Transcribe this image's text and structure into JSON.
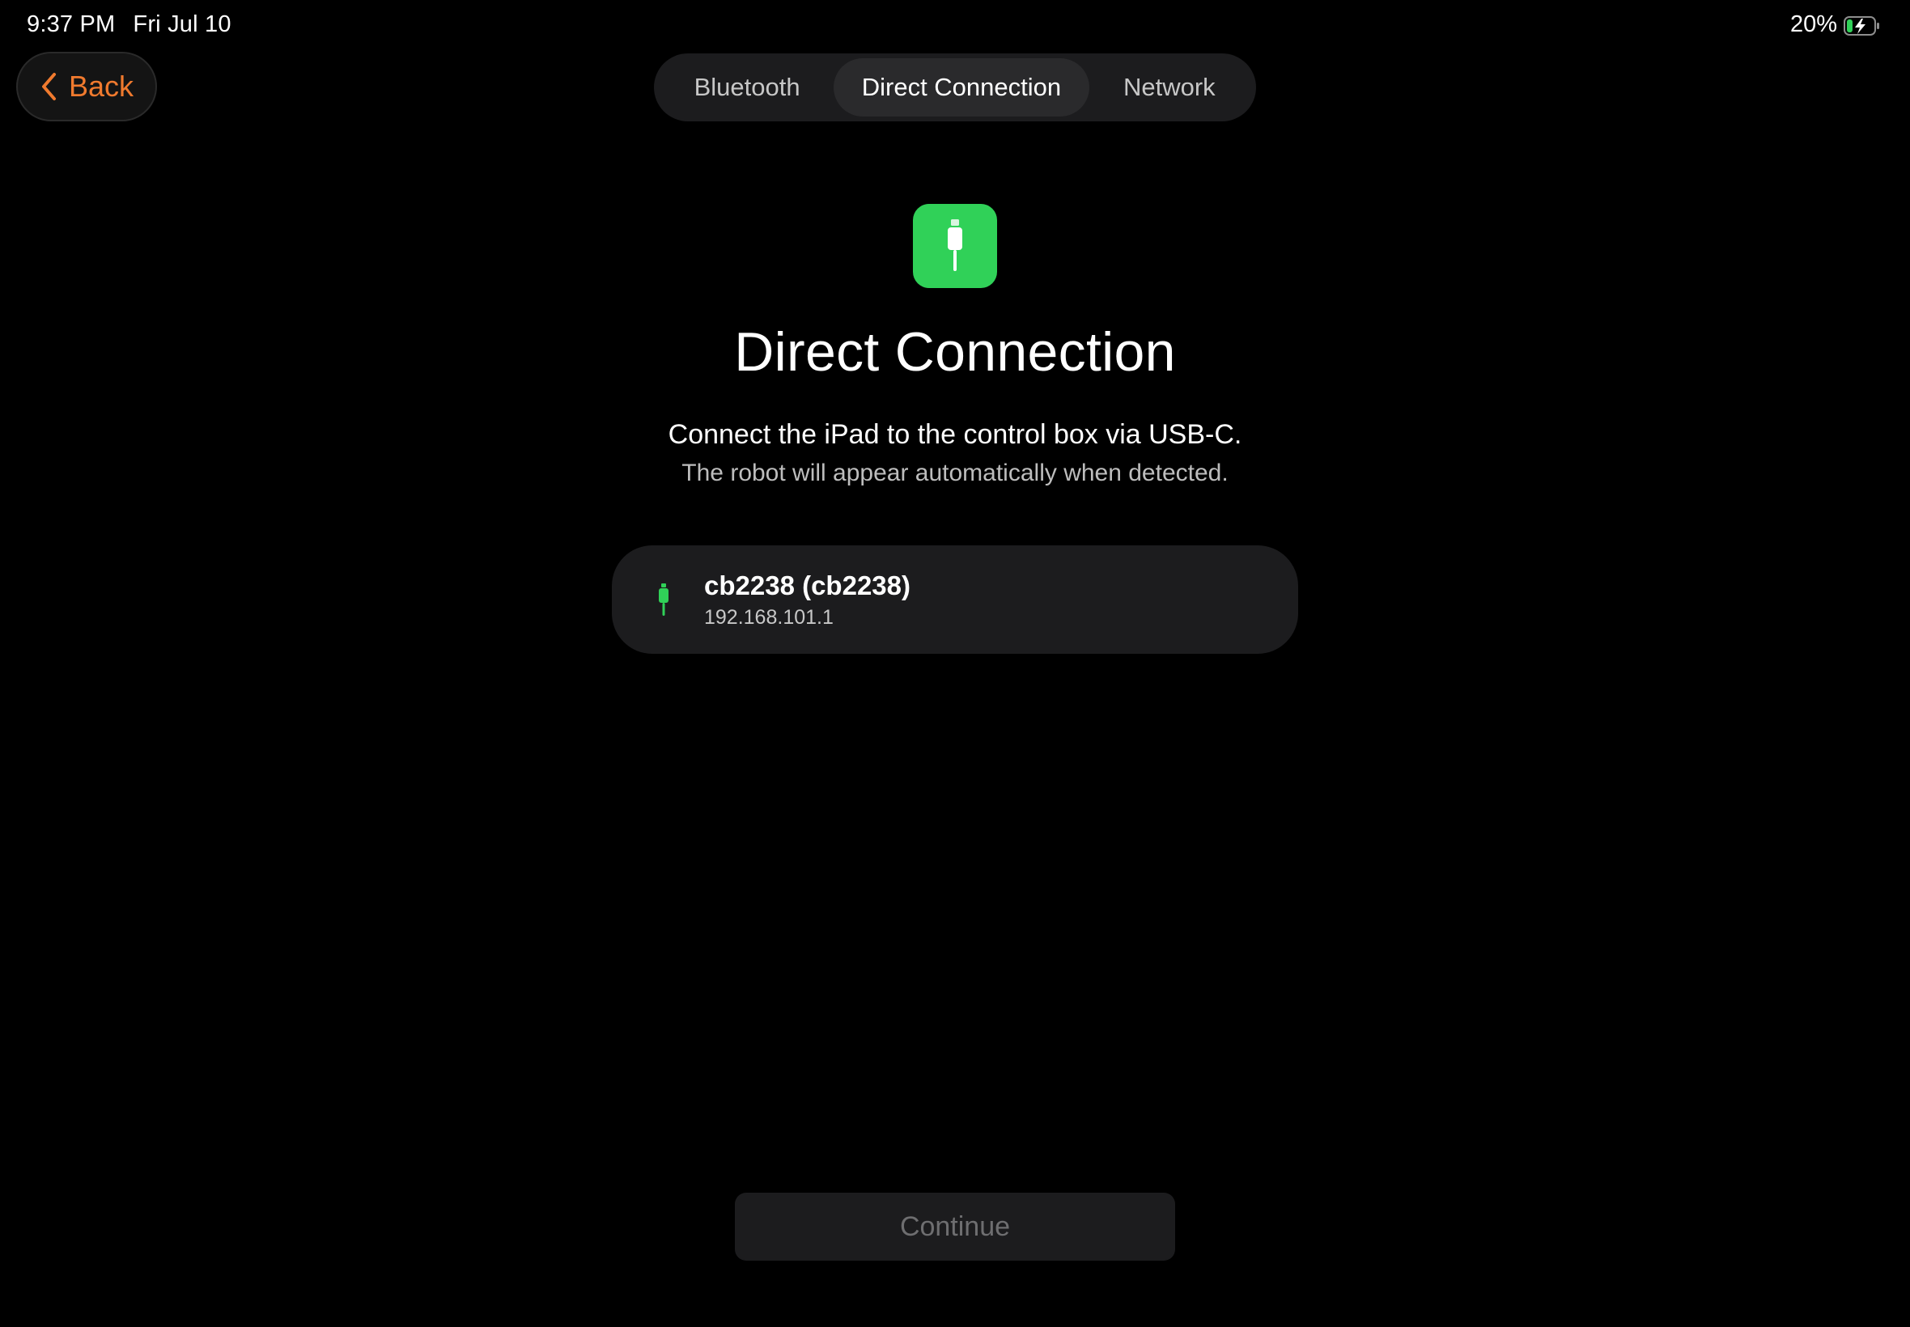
{
  "status_bar": {
    "time": "9:37 PM",
    "date": "Fri Jul 10",
    "battery_percent": "20%",
    "battery_level": 0.2,
    "battery_icon": "battery-charging-icon"
  },
  "nav": {
    "back_label": "Back",
    "back_icon": "chevron-left-icon",
    "accent_color": "#f07a2e"
  },
  "tabs": [
    {
      "label": "Bluetooth",
      "selected": false
    },
    {
      "label": "Direct Connection",
      "selected": true
    },
    {
      "label": "Network",
      "selected": false
    }
  ],
  "main": {
    "icon": "usb-cable-icon",
    "icon_color": "#30d158",
    "title": "Direct Connection",
    "subtitle": "Connect the iPad to the control box via USB-C.",
    "description": "The robot will appear automatically when detected."
  },
  "devices": [
    {
      "name": "cb2238 (cb2238)",
      "address": "192.168.101.1",
      "icon": "usb-cable-icon"
    }
  ],
  "footer": {
    "continue_label": "Continue",
    "continue_enabled": false
  }
}
